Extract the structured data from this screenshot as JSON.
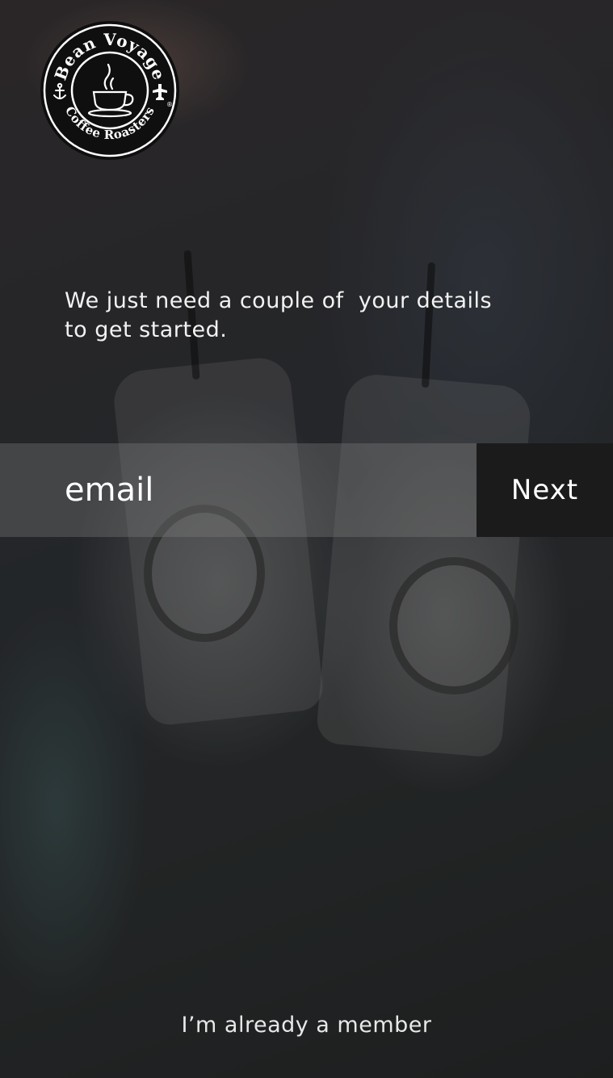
{
  "brand": {
    "name_top": "Bean Voyage",
    "name_bottom": "Coffee Roasters",
    "registered_mark": "®"
  },
  "intro": {
    "line1": "We just need a couple of  your details",
    "line2": "to get started."
  },
  "signup": {
    "email_placeholder": "email",
    "email_value": "",
    "next_label": "Next"
  },
  "footer": {
    "member_link": "I’m already a member"
  },
  "colors": {
    "button_bg": "#1b1b1b",
    "field_bg": "rgba(130,130,130,0.35)",
    "text": "#ffffff"
  }
}
